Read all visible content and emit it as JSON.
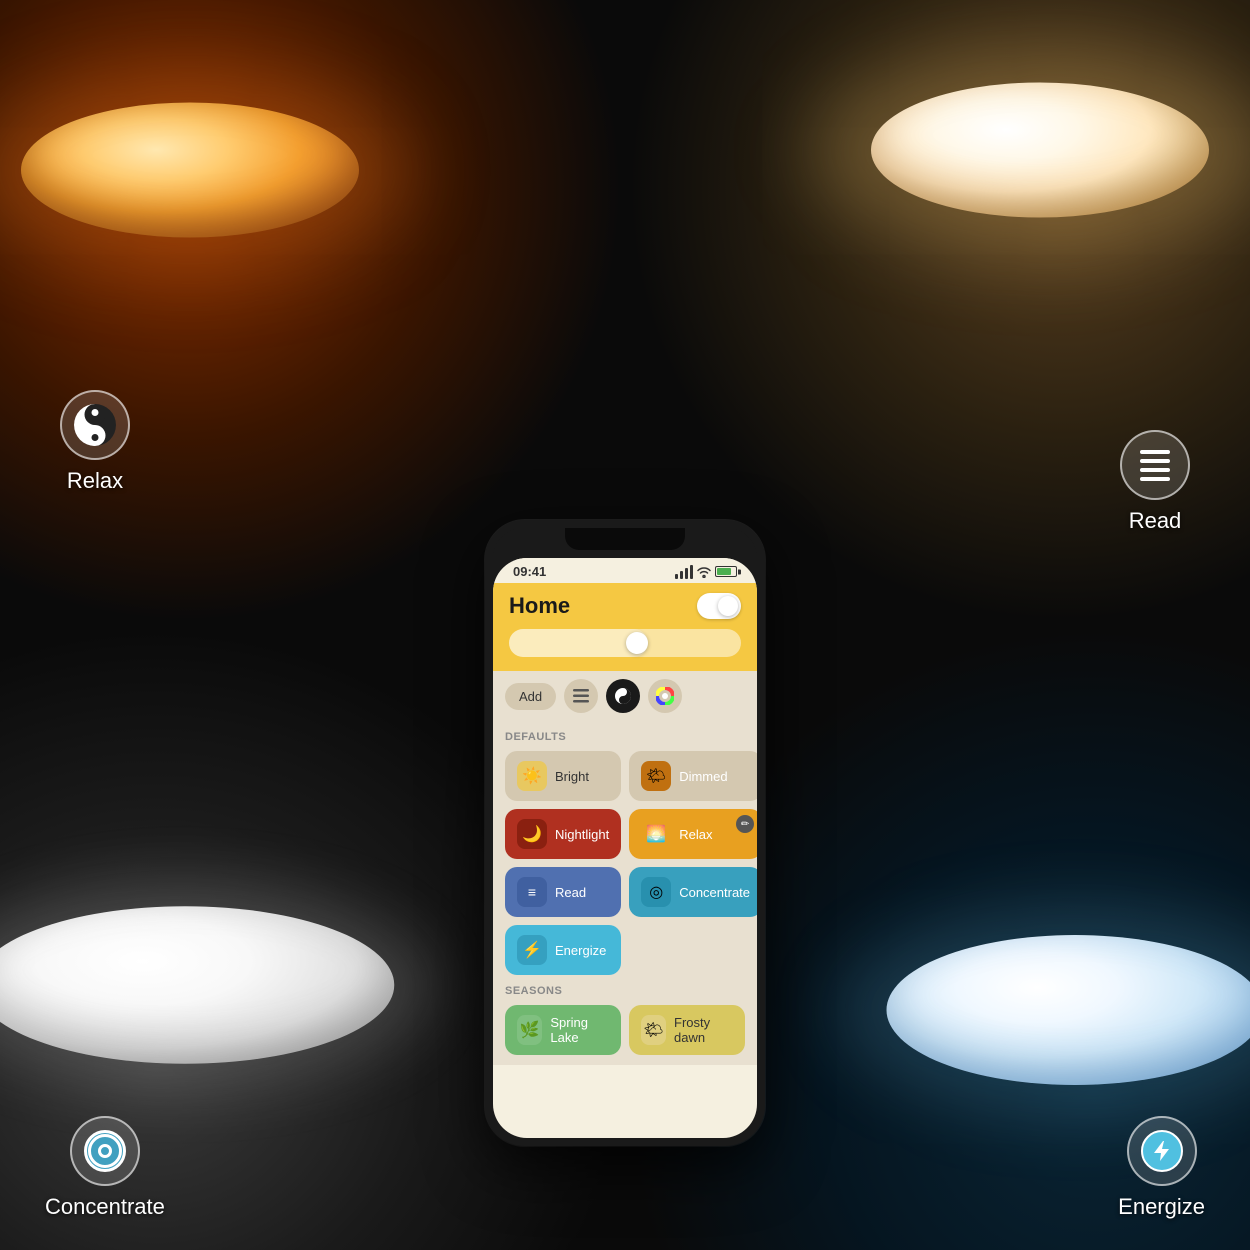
{
  "background": {
    "topLeft": "warm orange radial",
    "topRight": "warm white radial",
    "bottomLeft": "neutral gray radial",
    "bottomRight": "cool teal radial"
  },
  "labels": {
    "relax": "Relax",
    "read": "Read",
    "concentrate": "Concentrate",
    "energize": "Energize"
  },
  "phone": {
    "statusBar": {
      "time": "09:41",
      "batteryPercent": "75%"
    },
    "header": {
      "title": "Home",
      "toggleState": "on"
    },
    "toolbar": {
      "addButton": "Add"
    },
    "sections": {
      "defaults": "DEFAULTS",
      "seasons": "SEASONS"
    },
    "scenes": [
      {
        "id": "bright",
        "name": "Bright",
        "iconEmoji": "☀",
        "iconBg": "#e8c860",
        "active": false
      },
      {
        "id": "dimmed",
        "name": "Dimmed",
        "iconEmoji": "🌤",
        "iconBg": "#c07010",
        "active": false
      },
      {
        "id": "nightlight",
        "name": "Nightlight",
        "iconEmoji": "🌙",
        "iconBg": "#c03020",
        "active": false
      },
      {
        "id": "relax",
        "name": "Relax",
        "iconEmoji": "🌅",
        "iconBg": "#e8a020",
        "active": true
      },
      {
        "id": "read",
        "name": "Read",
        "iconEmoji": "≡",
        "iconBg": "#6080c0",
        "active": false
      },
      {
        "id": "concentrate",
        "name": "Concentrate",
        "iconEmoji": "◎",
        "iconBg": "#40a0c0",
        "active": false
      },
      {
        "id": "energize",
        "name": "Energize",
        "iconEmoji": "⚡",
        "iconBg": "#50c0e0",
        "active": false
      }
    ],
    "seasonScenes": [
      {
        "id": "springlake",
        "name": "Spring Lake",
        "iconEmoji": "🌿",
        "iconBg": "#80c080",
        "active": false
      },
      {
        "id": "frostydawn",
        "name": "Frosty dawn",
        "iconEmoji": "🌤",
        "iconBg": "#e0d080",
        "active": false
      }
    ]
  }
}
